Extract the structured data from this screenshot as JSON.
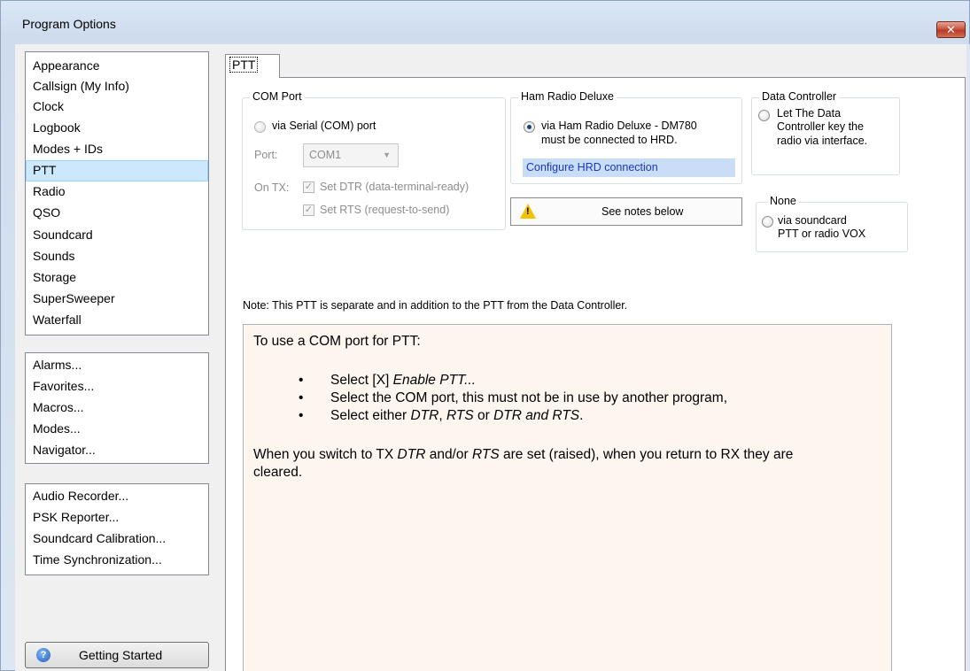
{
  "window": {
    "title": "Program Options",
    "close_label": "✕"
  },
  "sidebar": {
    "groups": [
      {
        "items": [
          {
            "label": "Appearance"
          },
          {
            "label": "Callsign (My Info)"
          },
          {
            "label": "Clock"
          },
          {
            "label": "Logbook"
          },
          {
            "label": "Modes + IDs"
          },
          {
            "label": "PTT",
            "selected": true
          },
          {
            "label": "Radio"
          },
          {
            "label": "QSO"
          },
          {
            "label": "Soundcard"
          },
          {
            "label": "Sounds"
          },
          {
            "label": "Storage"
          },
          {
            "label": "SuperSweeper"
          },
          {
            "label": "Waterfall"
          }
        ]
      },
      {
        "items": [
          {
            "label": "Alarms..."
          },
          {
            "label": "Favorites..."
          },
          {
            "label": "Macros..."
          },
          {
            "label": "Modes..."
          },
          {
            "label": "Navigator..."
          }
        ]
      },
      {
        "items": [
          {
            "label": "Audio Recorder..."
          },
          {
            "label": "PSK Reporter..."
          },
          {
            "label": "Soundcard Calibration..."
          },
          {
            "label": "Time Synchronization..."
          }
        ]
      }
    ],
    "getting_started_label": "Getting Started"
  },
  "tab": {
    "label": "PTT"
  },
  "com_port": {
    "title": "COM Port",
    "radio_label": "via Serial (COM) port",
    "port_label": "Port:",
    "port_value": "COM1",
    "on_tx_label": "On TX:",
    "dtr_label": "Set DTR (data-terminal-ready)",
    "rts_label": "Set RTS (request-to-send)",
    "dtr_checked": true,
    "rts_checked": true
  },
  "hrd": {
    "title": "Ham Radio Deluxe",
    "radio_line1": "via Ham Radio Deluxe - DM780",
    "radio_line2": "must be connected to HRD.",
    "link_label": "Configure HRD connection",
    "selected": true
  },
  "data_controller": {
    "title": "Data Controller",
    "line1": "Let The Data",
    "line2": "Controller key the",
    "line3": "radio via interface."
  },
  "none_group": {
    "title": "None",
    "line1": "via soundcard",
    "line2": "PTT or radio VOX"
  },
  "notes_button_label": "See notes below",
  "note_line": "Note: This PTT is separate and in addition to the PTT from the Data Controller.",
  "help": {
    "intro": "To use a COM port for PTT:",
    "bullets": [
      {
        "pre": "Select [X] ",
        "em": "Enable PTT...",
        "post": ""
      },
      {
        "pre": "Select the COM port, this must not be in use by another program,",
        "em": "",
        "post": ""
      },
      {
        "pre": "Select either ",
        "em": "DTR",
        "post": ", "
      }
    ],
    "bullet3_rts": "RTS",
    "bullet3_or": " or ",
    "bullet3_dtr_rts": "DTR and RTS",
    "bullet3_end": ".",
    "para_pre": "When you switch to TX ",
    "para_dtr": "DTR",
    "para_mid": " and/or ",
    "para_rts": "RTS",
    "para_post": " are set (raised), when you return to RX they are",
    "para_line2": "cleared."
  },
  "colors": {
    "selection_bg": "#cce8ff",
    "link_bg": "#c9ddf6",
    "link_text": "#1a39b8",
    "help_bg": "#fcf6ee"
  }
}
